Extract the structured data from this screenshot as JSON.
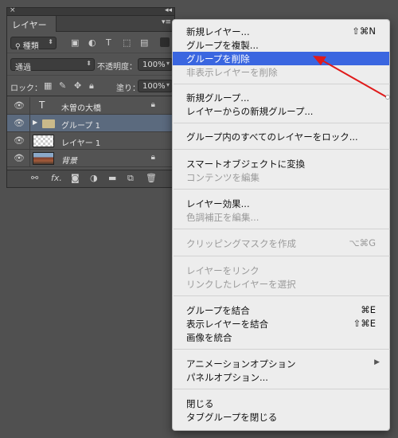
{
  "panel": {
    "title_left": "×",
    "title_right": "◂◂",
    "tab_label": "レイヤー",
    "menu_glyph": "▾≡",
    "filter": {
      "label": "種類",
      "icon": "search-icon"
    },
    "blend_mode": "通過",
    "opacity_label": "不透明度：",
    "opacity_value": "100%",
    "lock_label": "ロック：",
    "fill_label": "塗り：",
    "fill_value": "100%",
    "layers": [
      {
        "name": "木曽の大橋",
        "type": "text",
        "thumb": "T",
        "locked": true
      },
      {
        "name": "グループ 1",
        "type": "group",
        "selected": true
      },
      {
        "name": "レイヤー 1",
        "type": "layer"
      },
      {
        "name": "背景",
        "type": "background",
        "locked": true
      }
    ],
    "footer_icons": [
      "link-icon",
      "fx-icon",
      "mask-icon",
      "adjustment-icon",
      "folder-icon",
      "new-layer-icon",
      "trash-icon"
    ],
    "footer_fx": "fx."
  },
  "menu": {
    "items": [
      {
        "label": "新規レイヤー...",
        "shortcut": "⇧⌘N",
        "enabled": true
      },
      {
        "label": "グループを複製...",
        "enabled": true
      },
      {
        "label": "グループを削除",
        "enabled": true,
        "highlighted": true
      },
      {
        "label": "非表示レイヤーを削除",
        "enabled": false
      },
      {
        "label": "新規グループ...",
        "enabled": true
      },
      {
        "label": "レイヤーからの新規グループ...",
        "enabled": true
      },
      {
        "label": "グループ内のすべてのレイヤーをロック...",
        "enabled": true
      },
      {
        "label": "スマートオブジェクトに変換",
        "enabled": true
      },
      {
        "label": "コンテンツを編集",
        "enabled": false
      },
      {
        "label": "レイヤー効果...",
        "enabled": true
      },
      {
        "label": "色調補正を編集...",
        "enabled": false
      },
      {
        "label": "クリッピングマスクを作成",
        "shortcut": "⌥⌘G",
        "enabled": false
      },
      {
        "label": "レイヤーをリンク",
        "enabled": false
      },
      {
        "label": "リンクしたレイヤーを選択",
        "enabled": false
      },
      {
        "label": "グループを結合",
        "shortcut": "⌘E",
        "enabled": true
      },
      {
        "label": "表示レイヤーを結合",
        "shortcut": "⇧⌘E",
        "enabled": true
      },
      {
        "label": "画像を統合",
        "enabled": true
      },
      {
        "label": "アニメーションオプション",
        "submenu": true,
        "enabled": true
      },
      {
        "label": "パネルオプション...",
        "enabled": true
      },
      {
        "label": "閉じる",
        "enabled": true
      },
      {
        "label": "タブグループを閉じる",
        "enabled": true
      }
    ],
    "submenu_glyph": "▶"
  },
  "colors": {
    "highlight": "#3a66e0",
    "annotation_arrow": "#e01a1a",
    "panel_bg": "#535353",
    "selected_layer": "#5b6a7e"
  }
}
